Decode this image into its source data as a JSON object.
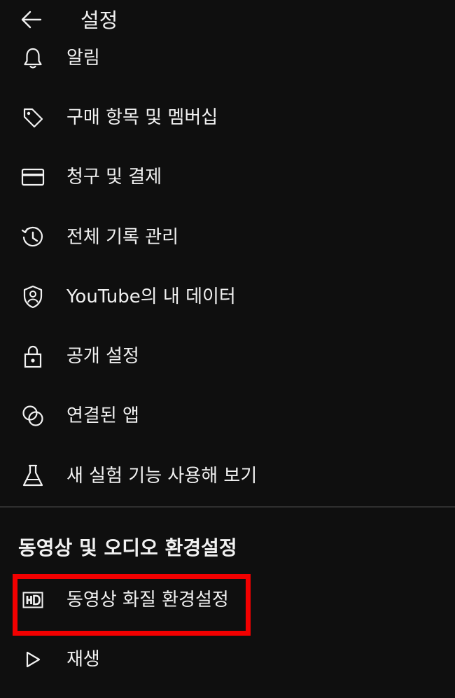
{
  "header": {
    "title": "설정",
    "back_icon": "arrow-left-icon"
  },
  "menu": {
    "items": [
      {
        "label": "알림",
        "icon": "bell-icon"
      },
      {
        "label": "구매 항목 및 멤버십",
        "icon": "tag-icon"
      },
      {
        "label": "청구 및 결제",
        "icon": "credit-card-icon"
      },
      {
        "label": "전체 기록 관리",
        "icon": "history-icon"
      },
      {
        "label": "YouTube의 내 데이터",
        "icon": "shield-person-icon"
      },
      {
        "label": "공개 설정",
        "icon": "lock-icon"
      },
      {
        "label": "연결된 앱",
        "icon": "linked-circles-icon"
      },
      {
        "label": "새 실험 기능 사용해 보기",
        "icon": "flask-icon"
      }
    ]
  },
  "video_audio": {
    "section_title": "동영상 및 오디오 환경설정",
    "items": [
      {
        "label": "동영상 화질 환경설정",
        "icon": "hd-icon"
      },
      {
        "label": "재생",
        "icon": "play-icon"
      }
    ]
  },
  "colors": {
    "background": "#0f0f0f",
    "text": "#f1f1f1",
    "highlight": "#f20000"
  }
}
